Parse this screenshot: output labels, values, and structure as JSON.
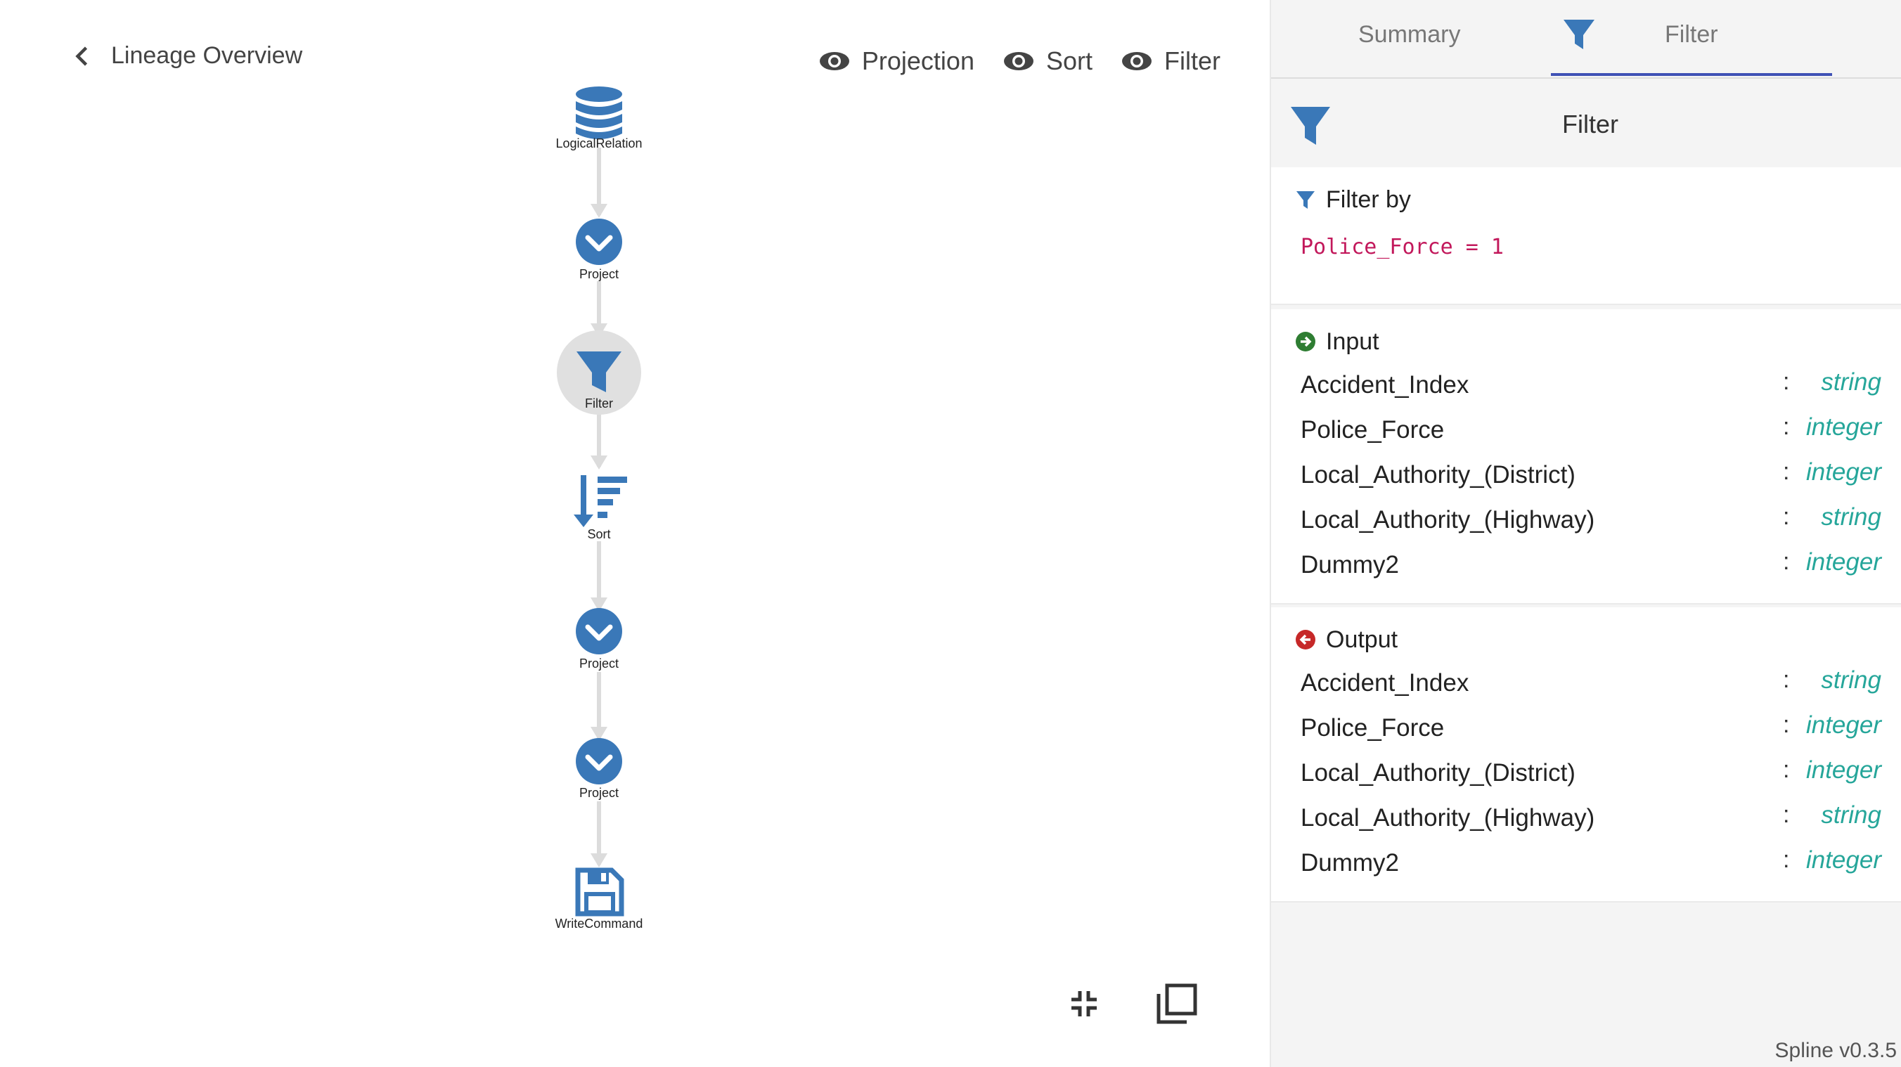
{
  "nav": {
    "back_label": "Lineage Overview"
  },
  "toggles": [
    {
      "label": "Projection",
      "icon": "eye-icon"
    },
    {
      "label": "Sort",
      "icon": "eye-icon"
    },
    {
      "label": "Filter",
      "icon": "eye-icon"
    }
  ],
  "graph": {
    "nodes": [
      {
        "label": "LogicalRelation",
        "icon": "database-icon"
      },
      {
        "label": "Project",
        "icon": "chevron-circle-icon"
      },
      {
        "label": "Filter",
        "icon": "filter-icon",
        "selected": true
      },
      {
        "label": "Sort",
        "icon": "sort-icon"
      },
      {
        "label": "Project",
        "icon": "chevron-circle-icon"
      },
      {
        "label": "Project",
        "icon": "chevron-circle-icon"
      },
      {
        "label": "WriteCommand",
        "icon": "save-icon"
      }
    ],
    "colors": {
      "node": "#3a78b8",
      "edge": "#dcdcdc",
      "selected_bg": "#e0e0e0"
    }
  },
  "tools": [
    {
      "icon": "collapse-icon"
    },
    {
      "icon": "copy-icon"
    }
  ],
  "panel": {
    "tabs": {
      "summary": "Summary",
      "filter": "Filter",
      "filter_icon": "filter-icon"
    },
    "header": {
      "title": "Filter",
      "icon": "filter-icon"
    },
    "filter_by": {
      "title": "Filter by",
      "expression": "Police_Force = 1"
    },
    "input": {
      "title": "Input",
      "attributes": [
        {
          "name": "Accident_Index",
          "type": "string"
        },
        {
          "name": "Police_Force",
          "type": "integer"
        },
        {
          "name": "Local_Authority_(District)",
          "type": "integer"
        },
        {
          "name": "Local_Authority_(Highway)",
          "type": "string"
        },
        {
          "name": "Dummy2",
          "type": "integer"
        }
      ]
    },
    "output": {
      "title": "Output",
      "attributes": [
        {
          "name": "Accident_Index",
          "type": "string"
        },
        {
          "name": "Police_Force",
          "type": "integer"
        },
        {
          "name": "Local_Authority_(District)",
          "type": "integer"
        },
        {
          "name": "Local_Authority_(Highway)",
          "type": "string"
        },
        {
          "name": "Dummy2",
          "type": "integer"
        }
      ]
    },
    "colors": {
      "accent": "#3f51b5",
      "type": "#26a69a",
      "code": "#c2185b",
      "input_icon": "#2e7d32",
      "output_icon": "#c62828"
    }
  },
  "version": "Spline v0.3.5"
}
